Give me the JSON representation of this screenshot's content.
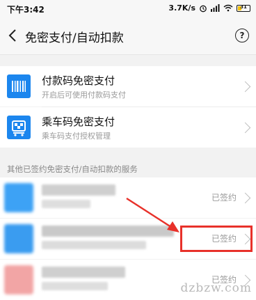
{
  "status": {
    "time": "下午3:42",
    "speed": "3.7K/s",
    "battery": "31"
  },
  "header": {
    "title": "免密支付/自动扣款",
    "help": "?"
  },
  "top_items": [
    {
      "title": "付款码免密支付",
      "subtitle": "开启后可使用付款码支付",
      "icon": "barcode-icon"
    },
    {
      "title": "乘车码免密支付",
      "subtitle": "乘车码支付授权管理",
      "icon": "bus-qr-icon"
    }
  ],
  "section_label": "其他已签约免密支付/自动扣款的服务",
  "services": [
    {
      "status": "已签约"
    },
    {
      "status": "已签约"
    },
    {
      "status": "已签约"
    }
  ],
  "watermark": "dzbzw.com",
  "colors": {
    "brand_blue": "#1c86ee",
    "annotation_red": "#e8312a"
  }
}
